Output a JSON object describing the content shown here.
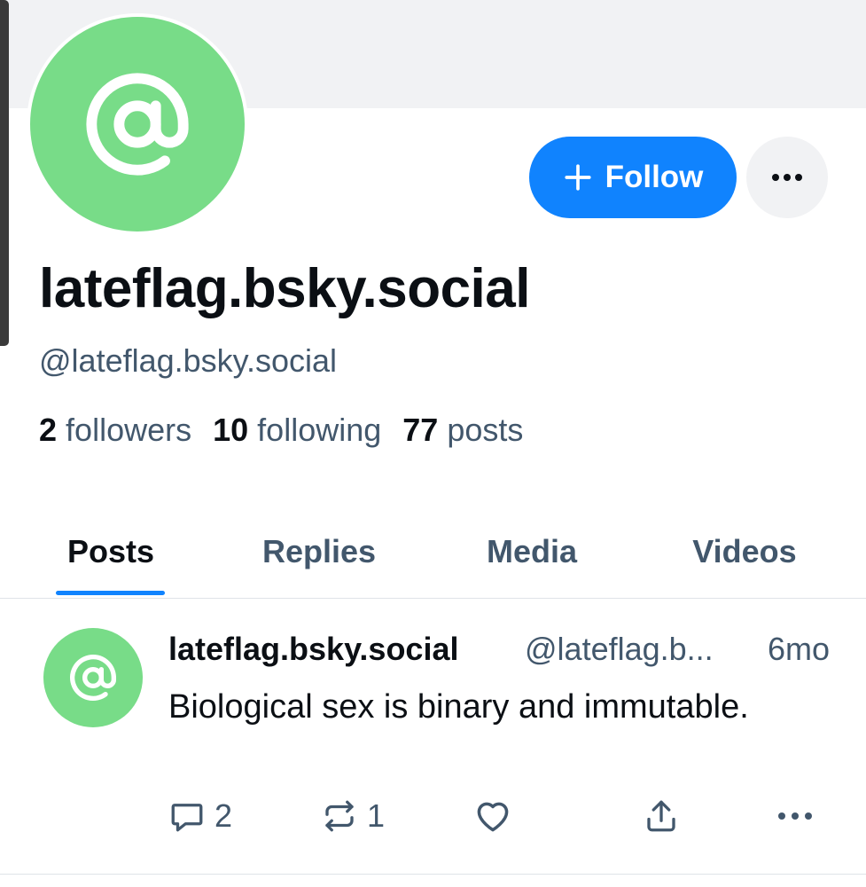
{
  "profile": {
    "display_name": "lateflag.bsky.social",
    "handle": "@lateflag.bsky.social",
    "avatar_color": "#78dc88",
    "avatar_icon": "at-sign-icon",
    "follow_label": "Follow",
    "stats": {
      "followers_count": "2",
      "followers_label": "followers",
      "following_count": "10",
      "following_label": "following",
      "posts_count": "77",
      "posts_label": "posts"
    }
  },
  "tabs": [
    {
      "label": "Posts",
      "active": true
    },
    {
      "label": "Replies",
      "active": false
    },
    {
      "label": "Media",
      "active": false
    },
    {
      "label": "Videos",
      "active": false
    }
  ],
  "post": {
    "author_name": "lateflag.bsky.social",
    "author_handle": "@lateflag.b...",
    "time": "6mo",
    "text": "Biological sex is binary and immutable.",
    "reply_count": "2",
    "repost_count": "1"
  },
  "colors": {
    "accent": "#1083fe",
    "muted_text": "#42576c",
    "banner": "#f1f2f4"
  }
}
